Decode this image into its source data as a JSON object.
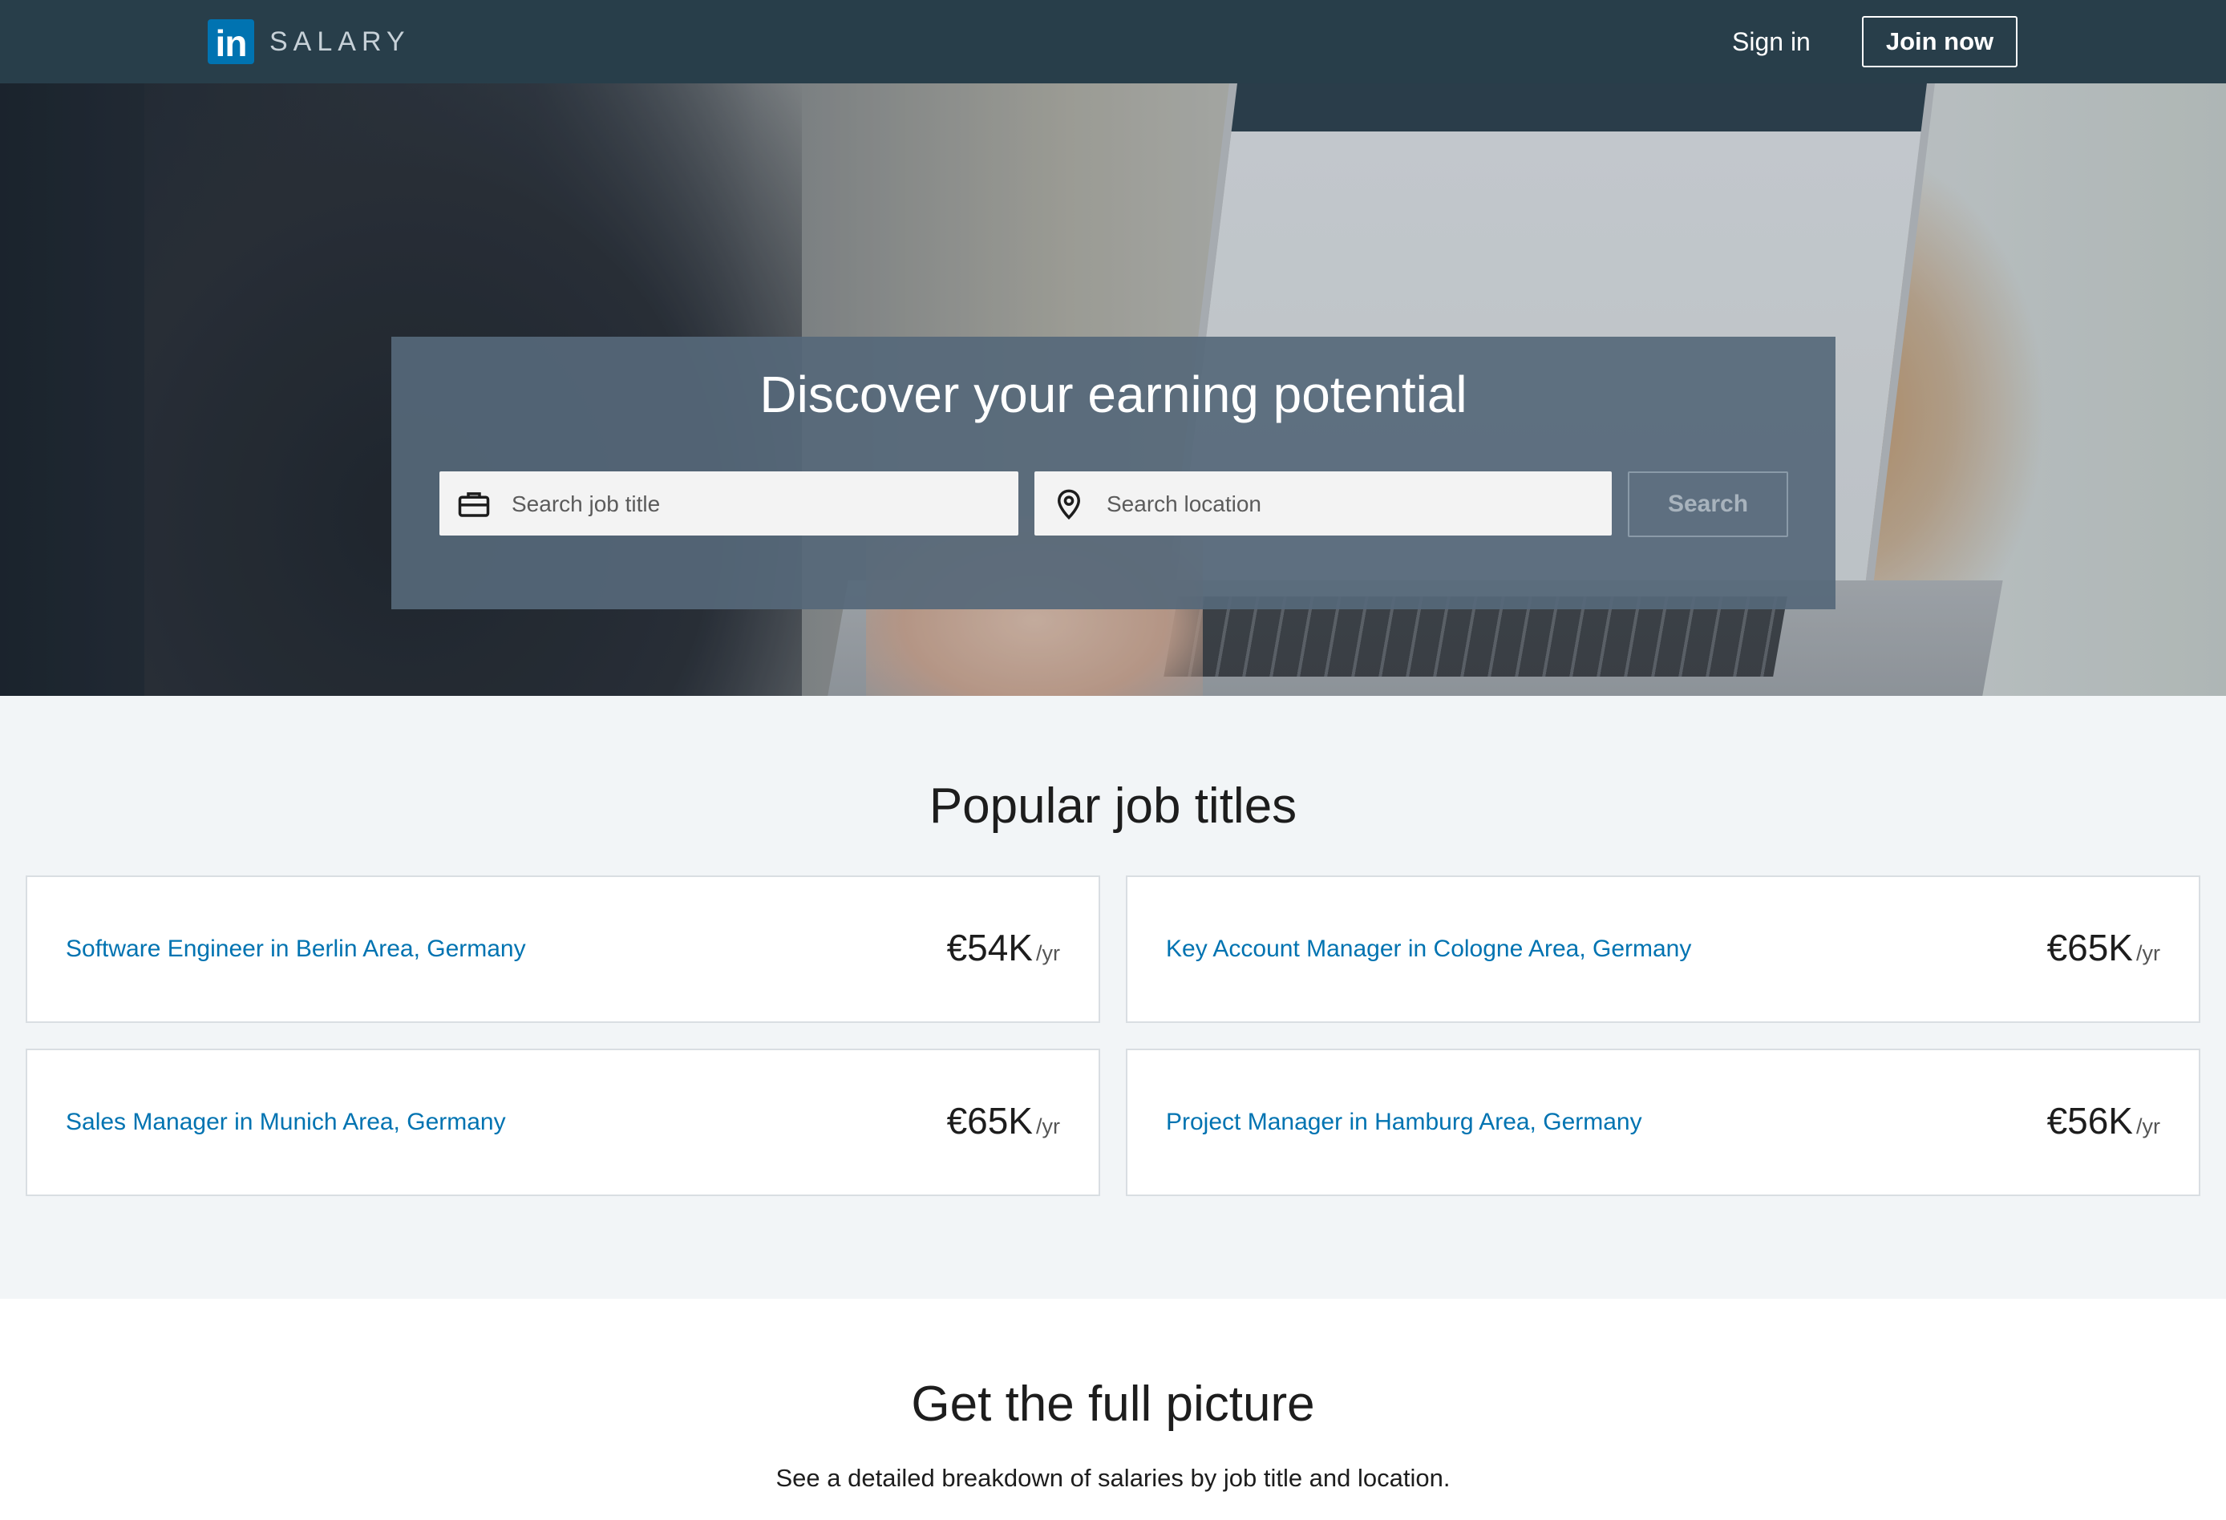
{
  "nav": {
    "logo_mark": "in",
    "logo_text": "SALARY",
    "signin_label": "Sign in",
    "join_label": "Join now"
  },
  "hero": {
    "title": "Discover your earning potential",
    "job_placeholder": "Search job title",
    "location_placeholder": "Search location",
    "search_label": "Search",
    "job_icon": "briefcase-icon",
    "location_icon": "location-pin-icon"
  },
  "popular": {
    "title": "Popular job titles",
    "cards": [
      {
        "title": "Software Engineer in Berlin Area, Germany",
        "salary": "€54K",
        "unit": "/yr"
      },
      {
        "title": "Key Account Manager in Cologne Area, Germany",
        "salary": "€65K",
        "unit": "/yr"
      },
      {
        "title": "Sales Manager in Munich Area, Germany",
        "salary": "€65K",
        "unit": "/yr"
      },
      {
        "title": "Project Manager in Hamburg Area, Germany",
        "salary": "€56K",
        "unit": "/yr"
      }
    ]
  },
  "full_picture": {
    "title": "Get the full picture",
    "subtitle": "See a detailed breakdown of salaries by job title and location."
  },
  "colors": {
    "nav_bg": "#283e4a",
    "brand_blue": "#0073b1",
    "panel_bg": "#56687a",
    "section_bg": "#f2f5f7"
  }
}
